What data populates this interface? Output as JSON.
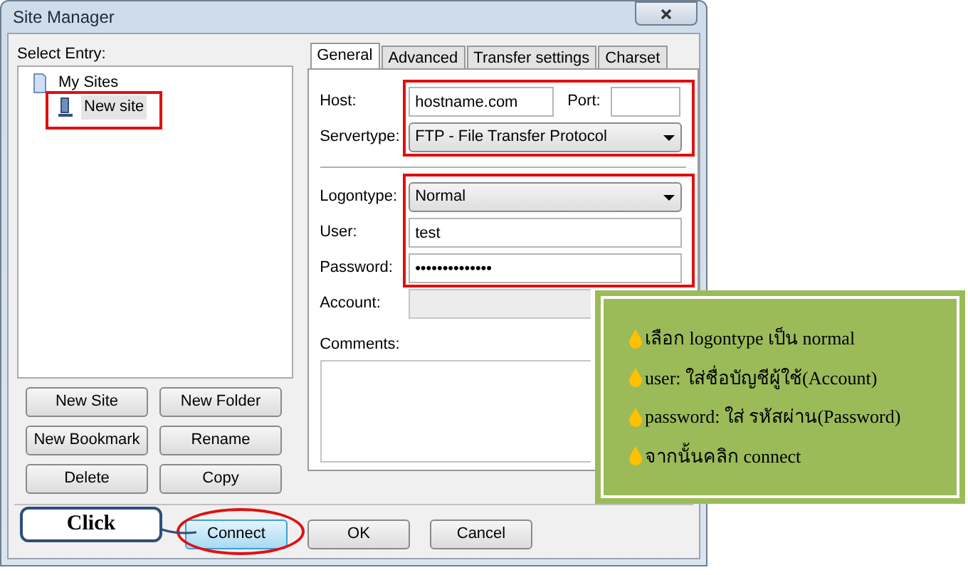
{
  "window": {
    "title": "Site Manager"
  },
  "select_entry": {
    "label": "Select Entry:",
    "tree": [
      {
        "label": "My Sites",
        "selected": false,
        "children": [
          {
            "label": "New site",
            "selected": true
          }
        ]
      }
    ]
  },
  "entry_buttons": [
    "New Site",
    "New Folder",
    "New Bookmark",
    "Rename",
    "Delete",
    "Copy"
  ],
  "tabs": [
    {
      "label": "General",
      "selected": true
    },
    {
      "label": "Advanced",
      "selected": false
    },
    {
      "label": "Transfer settings",
      "selected": false
    },
    {
      "label": "Charset",
      "selected": false
    }
  ],
  "general": {
    "host": {
      "label": "Host:",
      "value": "hostname.com"
    },
    "port": {
      "label": "Port:"
    },
    "servertype": {
      "label": "Servertype:",
      "value": "FTP - File Transfer Protocol"
    },
    "logontype": {
      "label": "Logontype:",
      "value": "Normal"
    },
    "user": {
      "label": "User:",
      "value": "test"
    },
    "password": {
      "label": "Password:",
      "value": "••••••••••••••"
    },
    "account": {
      "label": "Account:",
      "disabled": true
    },
    "comments": {
      "label": "Comments:"
    }
  },
  "dialog_buttons": [
    {
      "label": "Connect",
      "focused": true
    },
    {
      "label": "OK",
      "focused": false
    },
    {
      "label": "Cancel",
      "focused": false
    }
  ],
  "callout": {
    "label": "Click"
  },
  "note": {
    "lines": [
      "เลือก logontype เป็น normal",
      "user: ใส่ชื่อบัญชีผู้ใช้(Account)",
      "password: ใส่ รหัสผ่าน(Password)",
      "จากนั้นคลิก connect"
    ]
  }
}
